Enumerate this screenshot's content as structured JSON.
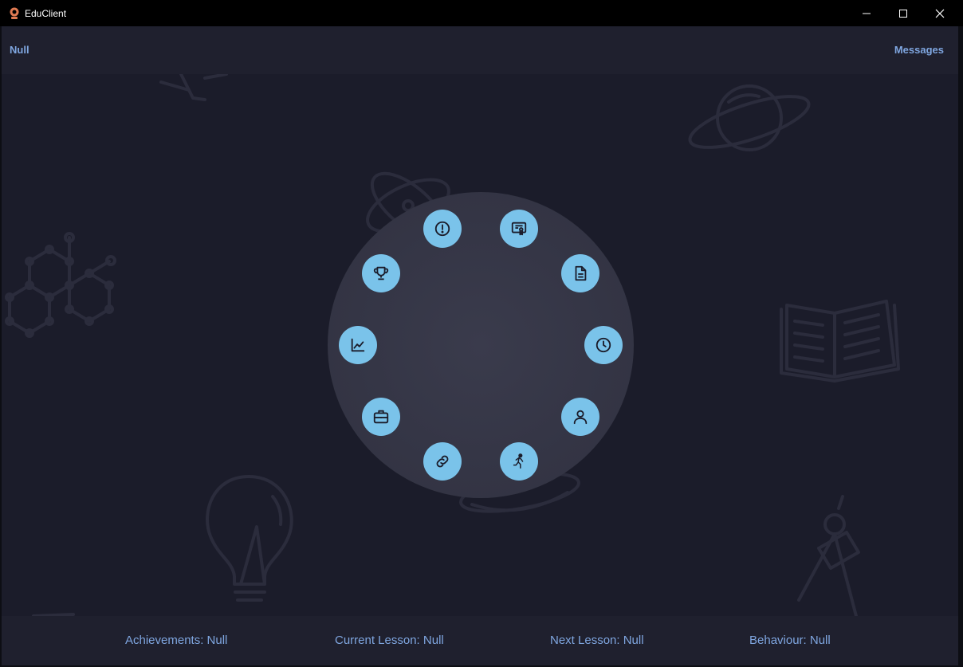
{
  "window": {
    "title": "EduClient",
    "icon": "app-logo-icon",
    "controls": [
      "minimize-icon",
      "maximize-icon",
      "close-icon"
    ]
  },
  "header": {
    "left_label": "Null",
    "right_label": "Messages"
  },
  "dial": {
    "buttons": [
      {
        "name": "alert-circle-icon"
      },
      {
        "name": "certificate-icon"
      },
      {
        "name": "document-icon"
      },
      {
        "name": "clock-icon"
      },
      {
        "name": "user-icon"
      },
      {
        "name": "running-icon"
      },
      {
        "name": "link-icon"
      },
      {
        "name": "briefcase-icon"
      },
      {
        "name": "chart-icon"
      },
      {
        "name": "trophy-icon"
      }
    ]
  },
  "footer": {
    "achievements": "Achievements: Null",
    "current_lesson": "Current Lesson: Null",
    "next_lesson": "Next Lesson: Null",
    "behaviour": "Behaviour: Null"
  },
  "colors": {
    "accent": "#7fa6e0",
    "dial_button": "#7ac3ea",
    "background": "#1b1c2a",
    "bar": "#1f202e",
    "titlebar": "#000000"
  }
}
